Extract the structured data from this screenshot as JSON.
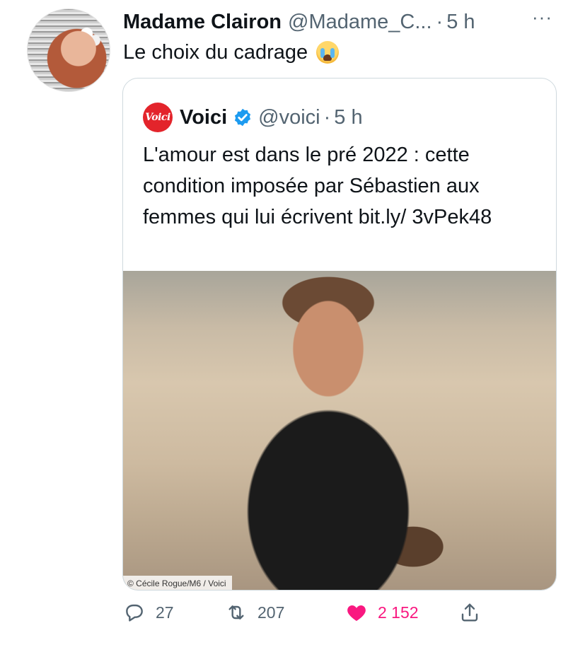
{
  "author": {
    "display_name": "Madame Clairon",
    "handle": "@Madame_C...",
    "separator": "·",
    "time": "5 h"
  },
  "tweet": {
    "text": "Le choix du cadrage",
    "emoji": "loudly-crying-face"
  },
  "quoted": {
    "logo_text": "Voici",
    "display_name": "Voici",
    "verified": true,
    "handle": "@voici",
    "separator": "·",
    "time": "5 h",
    "text": "L'amour est dans le pré 2022 : cette condition imposée par Sébastien aux femmes qui lui écrivent bit.ly/ 3vPek48",
    "photo_credit": "© Cécile Rogue/M6 / Voici"
  },
  "actions": {
    "replies": "27",
    "retweets": "207",
    "likes": "2 152",
    "liked": true
  },
  "colors": {
    "text": "#0f1419",
    "secondary": "#536471",
    "like": "#f91880",
    "verified": "#1d9bf0",
    "brand": "#e3242b"
  }
}
